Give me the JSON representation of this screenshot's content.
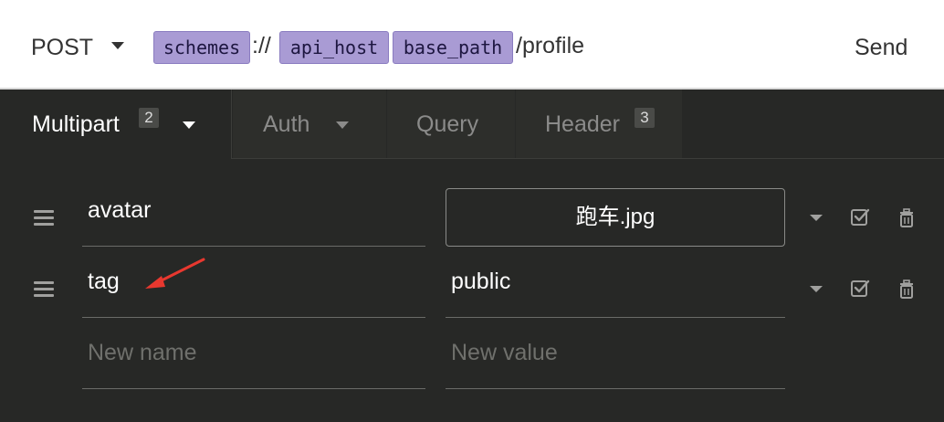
{
  "request": {
    "method": "POST",
    "url_vars": [
      "schemes",
      "api_host",
      "base_path"
    ],
    "url_separator": "://",
    "url_path": "/profile",
    "send_label": "Send"
  },
  "tabs": [
    {
      "label": "Multipart",
      "count": "2"
    },
    {
      "label": "Auth"
    },
    {
      "label": "Query"
    },
    {
      "label": "Header",
      "count": "3"
    }
  ],
  "params": [
    {
      "name": "avatar",
      "value": "跑车.jpg",
      "is_file": true
    },
    {
      "name": "tag",
      "value": "public",
      "is_file": false
    }
  ],
  "new_row": {
    "name_placeholder": "New name",
    "value_placeholder": "New value"
  },
  "colors": {
    "env_tag": "#a99bd4",
    "background": "#272826",
    "annotation_arrow": "#e8382f"
  },
  "icons": [
    "caret-down-icon",
    "drag-handle-icon",
    "checkbox-checked-icon",
    "trash-icon",
    "annotation-arrow"
  ]
}
